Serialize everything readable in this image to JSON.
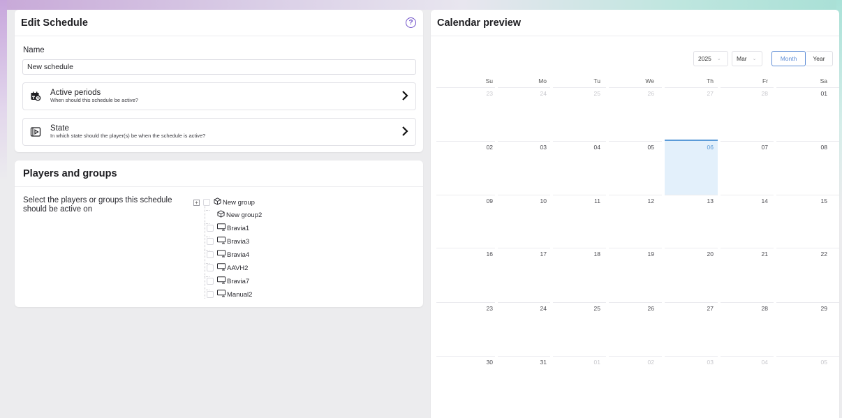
{
  "edit": {
    "title": "Edit Schedule",
    "help": "?",
    "name_label": "Name",
    "name_value": "New schedule",
    "rows": [
      {
        "title": "Active periods",
        "subtitle": "When should this schedule be active?"
      },
      {
        "title": "State",
        "subtitle": "In which state should the player(s) be when the schedule is active?"
      }
    ]
  },
  "players": {
    "title": "Players and groups",
    "instruction": "Select the players or groups this schedule should be active on",
    "tree": [
      {
        "label": "New group",
        "type": "group",
        "expander": "+"
      },
      {
        "label": "New group2",
        "type": "group"
      },
      {
        "label": "Bravia1",
        "type": "player"
      },
      {
        "label": "Bravia3",
        "type": "player"
      },
      {
        "label": "Bravia4",
        "type": "player"
      },
      {
        "label": "AAVH2",
        "type": "player"
      },
      {
        "label": "Bravia7",
        "type": "player"
      },
      {
        "label": "Manual2",
        "type": "player"
      }
    ]
  },
  "calendar": {
    "title": "Calendar preview",
    "year": "2025",
    "month": "Mar",
    "mode_month": "Month",
    "mode_year": "Year",
    "days": [
      "Su",
      "Mo",
      "Tu",
      "We",
      "Th",
      "Fr",
      "Sa"
    ],
    "today": "06",
    "weeks": [
      [
        {
          "d": "23",
          "dim": true
        },
        {
          "d": "24",
          "dim": true
        },
        {
          "d": "25",
          "dim": true
        },
        {
          "d": "26",
          "dim": true
        },
        {
          "d": "27",
          "dim": true
        },
        {
          "d": "28",
          "dim": true
        },
        {
          "d": "01",
          "dim": false
        }
      ],
      [
        {
          "d": "02",
          "dim": false
        },
        {
          "d": "03",
          "dim": false
        },
        {
          "d": "04",
          "dim": false
        },
        {
          "d": "05",
          "dim": false
        },
        {
          "d": "06",
          "dim": false
        },
        {
          "d": "07",
          "dim": false
        },
        {
          "d": "08",
          "dim": false
        }
      ],
      [
        {
          "d": "09",
          "dim": false
        },
        {
          "d": "10",
          "dim": false
        },
        {
          "d": "11",
          "dim": false
        },
        {
          "d": "12",
          "dim": false
        },
        {
          "d": "13",
          "dim": false
        },
        {
          "d": "14",
          "dim": false
        },
        {
          "d": "15",
          "dim": false
        }
      ],
      [
        {
          "d": "16",
          "dim": false
        },
        {
          "d": "17",
          "dim": false
        },
        {
          "d": "18",
          "dim": false
        },
        {
          "d": "19",
          "dim": false
        },
        {
          "d": "20",
          "dim": false
        },
        {
          "d": "21",
          "dim": false
        },
        {
          "d": "22",
          "dim": false
        }
      ],
      [
        {
          "d": "23",
          "dim": false
        },
        {
          "d": "24",
          "dim": false
        },
        {
          "d": "25",
          "dim": false
        },
        {
          "d": "26",
          "dim": false
        },
        {
          "d": "27",
          "dim": false
        },
        {
          "d": "28",
          "dim": false
        },
        {
          "d": "29",
          "dim": false
        }
      ],
      [
        {
          "d": "30",
          "dim": false
        },
        {
          "d": "31",
          "dim": false
        },
        {
          "d": "01",
          "dim": true
        },
        {
          "d": "02",
          "dim": true
        },
        {
          "d": "03",
          "dim": true
        },
        {
          "d": "04",
          "dim": true
        },
        {
          "d": "05",
          "dim": true
        }
      ]
    ]
  },
  "colors": {
    "accent": "#6e4fc8",
    "today_fill": "#e3f0fb",
    "today_border": "#5b9bd8",
    "mode_active": "#5e8dd6"
  },
  "icons": {
    "help": "question-circle-icon",
    "active_periods": "calendar-clock-icon",
    "state": "play-square-icon",
    "group": "cube-icon",
    "player": "monitor-icon"
  }
}
